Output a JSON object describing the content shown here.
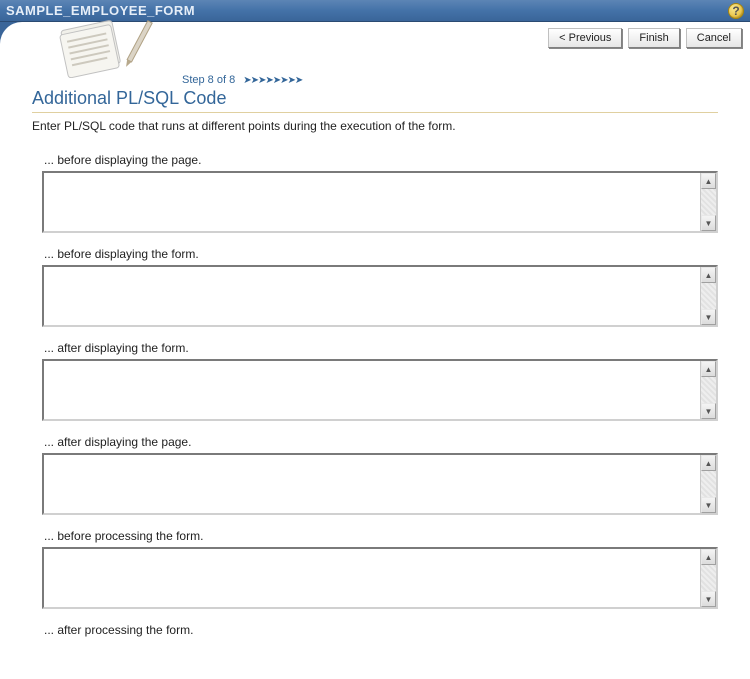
{
  "header": {
    "title": "SAMPLE_EMPLOYEE_FORM",
    "help_label": "?"
  },
  "buttons": {
    "previous": "< Previous",
    "finish": "Finish",
    "cancel": "Cancel"
  },
  "step": {
    "text": "Step 8 of 8"
  },
  "page": {
    "title": "Additional PL/SQL Code",
    "instruction": "Enter PL/SQL code that runs at different points during the execution of the form."
  },
  "fields": [
    {
      "label": "... before displaying the page.",
      "value": ""
    },
    {
      "label": "... before displaying the form.",
      "value": ""
    },
    {
      "label": "... after displaying the form.",
      "value": ""
    },
    {
      "label": "... after displaying the page.",
      "value": ""
    },
    {
      "label": "... before processing the form.",
      "value": ""
    },
    {
      "label": "... after processing the form.",
      "value": ""
    }
  ]
}
